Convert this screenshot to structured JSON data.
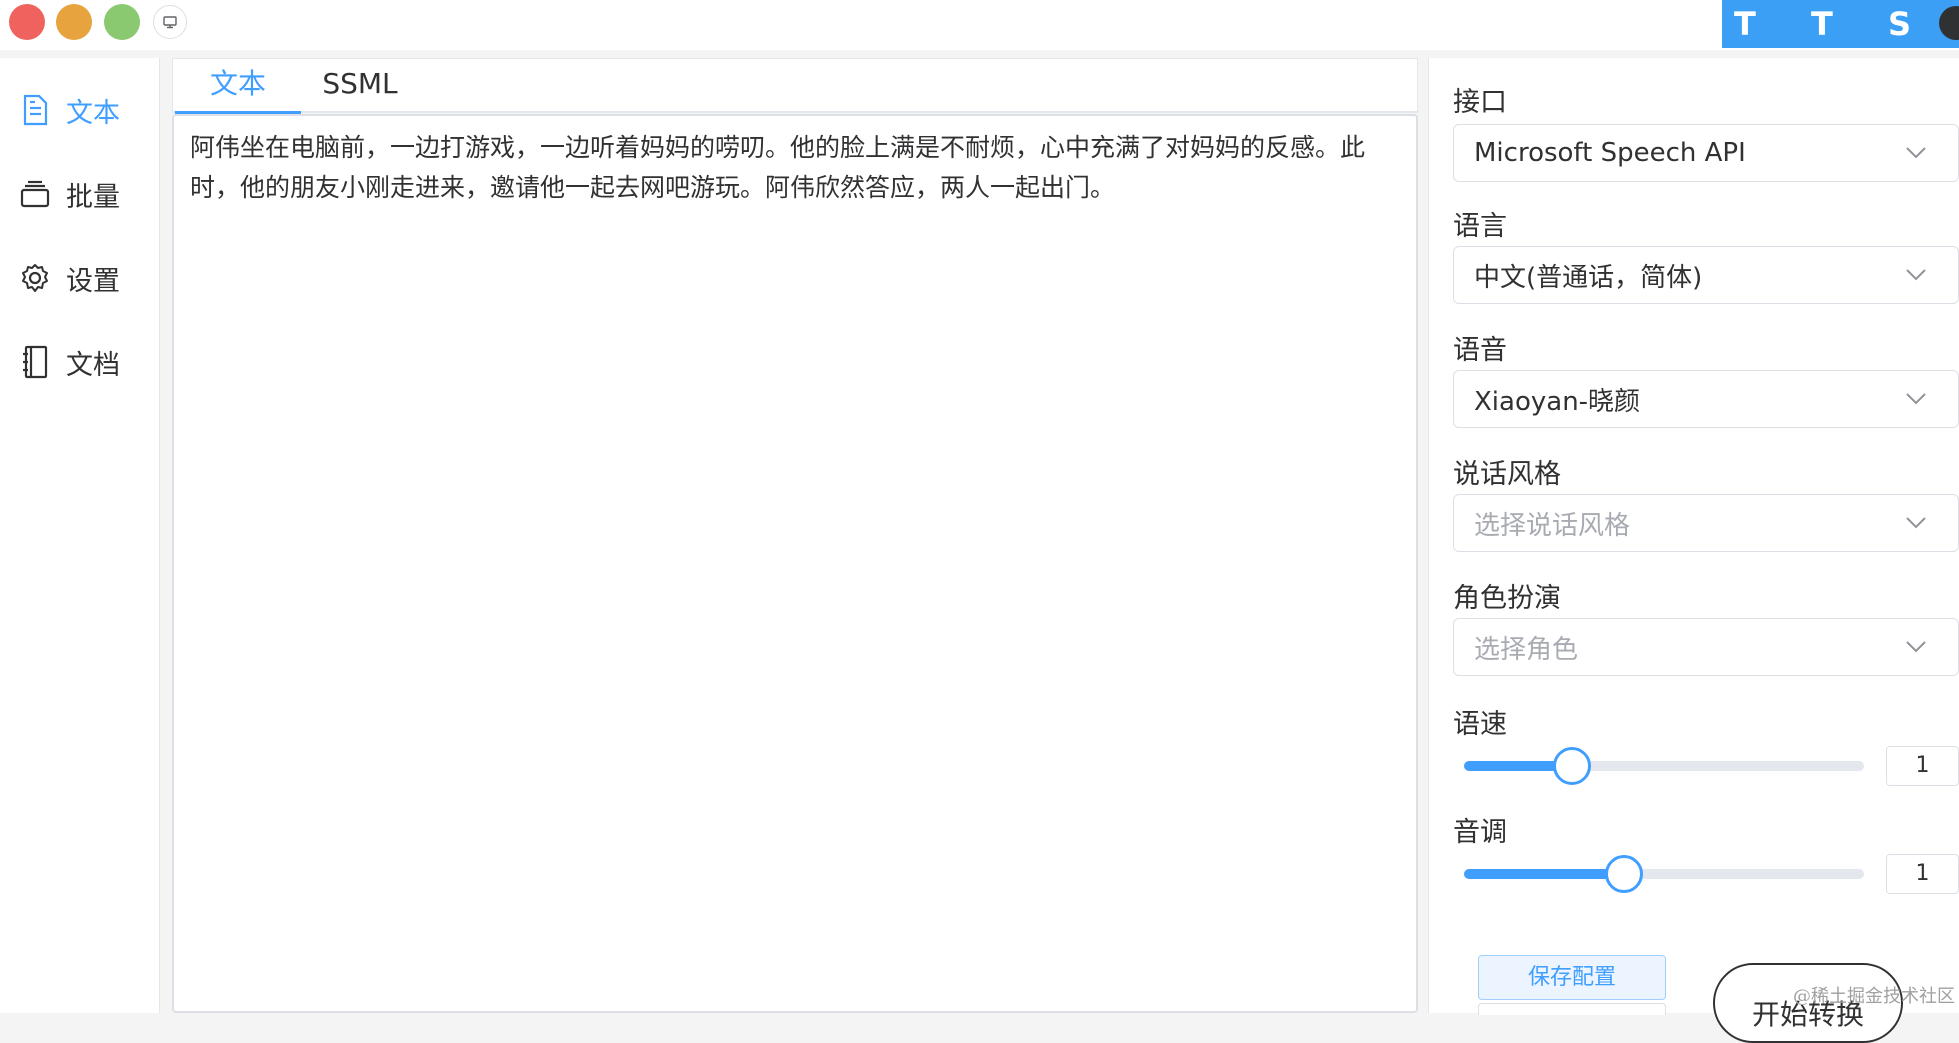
{
  "window": {
    "brand": "T T S - V U"
  },
  "sidebar": {
    "items": [
      {
        "label": "文本",
        "icon": "document-icon"
      },
      {
        "label": "批量",
        "icon": "stack-icon"
      },
      {
        "label": "设置",
        "icon": "gear-icon"
      },
      {
        "label": "文档",
        "icon": "notebook-icon"
      }
    ]
  },
  "tabs": {
    "items": [
      {
        "label": "文本"
      },
      {
        "label": "SSML"
      }
    ],
    "active": "文本"
  },
  "editor": {
    "text": "阿伟坐在电脑前，一边打游戏，一边听着妈妈的唠叨。他的脸上满是不耐烦，心中充满了对妈妈的反感。此时，他的朋友小刚走进来，邀请他一起去网吧游玩。阿伟欣然答应，两人一起出门。"
  },
  "settings": {
    "api": {
      "label": "接口",
      "value": "Microsoft Speech API"
    },
    "language": {
      "label": "语言",
      "value": "中文(普通话，简体)"
    },
    "voice": {
      "label": "语音",
      "value": "Xiaoyan-晓颜"
    },
    "style": {
      "label": "说话风格",
      "placeholder": "选择说话风格"
    },
    "role": {
      "label": "角色扮演",
      "placeholder": "选择角色"
    },
    "rate": {
      "label": "语速",
      "value": "1",
      "fraction": 0.27
    },
    "pitch": {
      "label": "音调",
      "value": "1",
      "fraction": 0.4
    }
  },
  "actions": {
    "save_label": "保存配置",
    "start_label": "开始转换"
  },
  "watermark": "@稀土掘金技术社区",
  "colors": {
    "accent": "#409eff",
    "brand_bg": "#3a9ff5",
    "close": "#f0625e",
    "minimize": "#e7a33e",
    "maximize": "#8bc970"
  }
}
